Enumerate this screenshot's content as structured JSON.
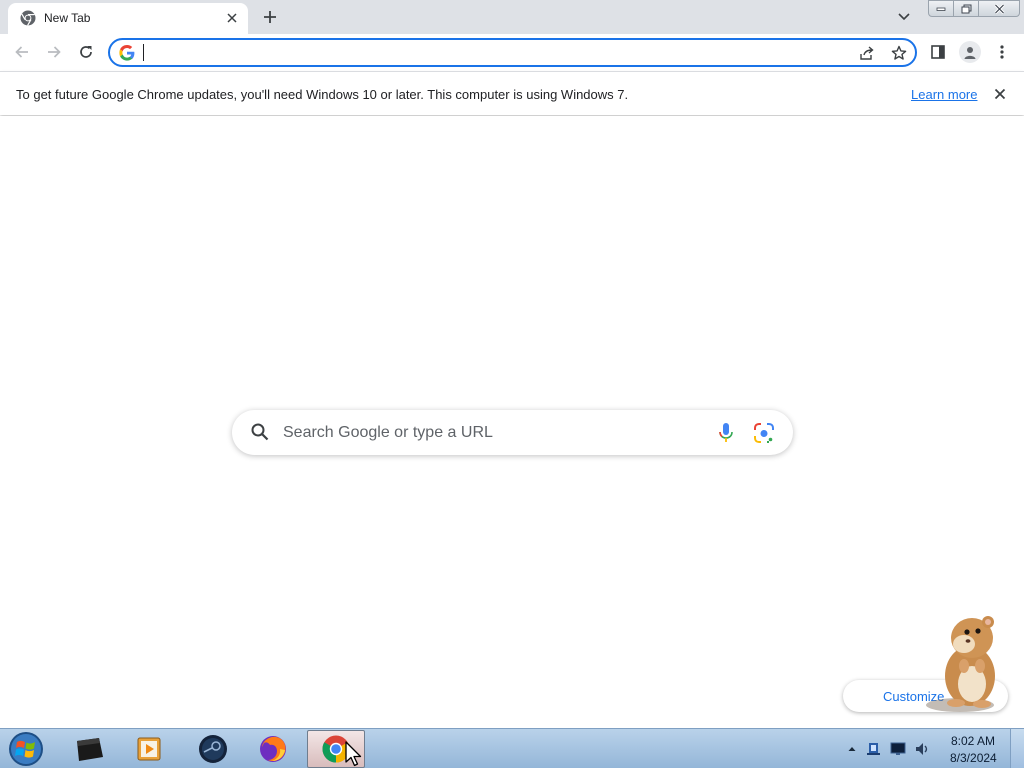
{
  "browser": {
    "tab": {
      "title": "New Tab"
    },
    "omnibox": {
      "value": "",
      "placeholder": ""
    },
    "colors": {
      "accent": "#1a73e8",
      "tabstrip": "#dee1e6"
    }
  },
  "infobar": {
    "message": "To get future Google Chrome updates, you'll need Windows 10 or later. This computer is using Windows 7.",
    "link": "Learn more"
  },
  "ntp": {
    "search_placeholder": "Search Google or type a URL",
    "customize_label": "Customize"
  },
  "taskbar": {
    "apps": [
      "command-prompt",
      "media-player",
      "steam",
      "firefox",
      "chrome"
    ],
    "clock": {
      "time": "8:02 AM",
      "date": "8/3/2024"
    }
  }
}
